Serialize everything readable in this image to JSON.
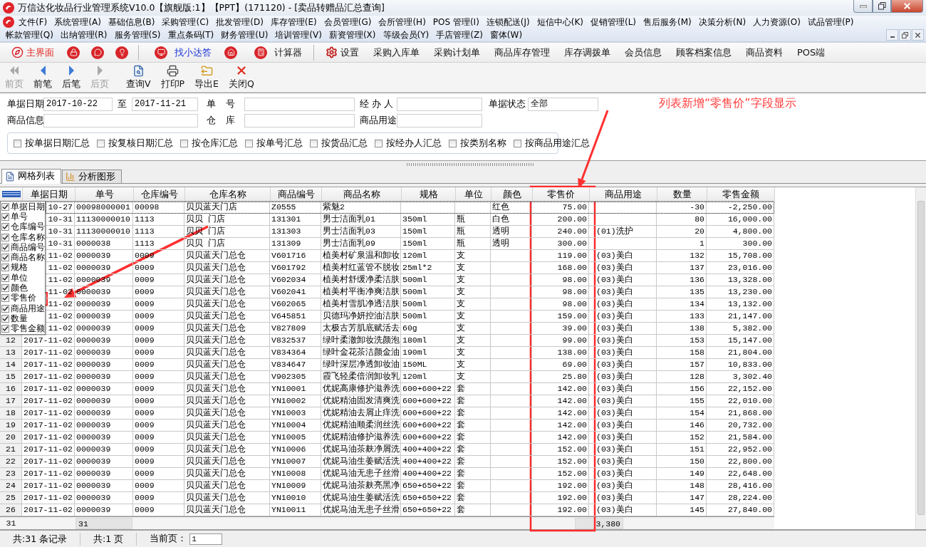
{
  "window": {
    "title": "万信达化妆品行业管理系统V10.0【旗舰版:1】【PPT】(171120) - [卖品转赠品汇总查询]"
  },
  "menu_rows": [
    [
      "文件(F)",
      "系统管理(A)",
      "基础信息(B)",
      "采购管理(C)",
      "批发管理(D)",
      "库存管理(E)",
      "会员管理(G)",
      "会所管理(H)",
      "POS 管理(I)",
      "连锁配送(J)",
      "短信中心(K)",
      "促销管理(L)",
      "售后服务(M)",
      "决策分析(N)",
      "人力资源(O)",
      "试品管理(P)"
    ],
    [
      "帐款管理(Q)",
      "出纳管理(R)",
      "服务管理(S)",
      "重点条码(T)",
      "财务管理(U)",
      "培训管理(V)",
      "薪资管理(X)",
      "等级会员(Y)",
      "手店管理(Z)",
      "窗体(W)"
    ]
  ],
  "quick_toolbar": [
    {
      "label": "主界面",
      "kind": "red"
    },
    {
      "label": "找小达答",
      "kind": "blue"
    },
    {
      "label": "计算器",
      "kind": "plain"
    },
    {
      "label": "设置",
      "kind": "plain"
    },
    {
      "label": "采购入库单",
      "kind": "plain"
    },
    {
      "label": "采购计划单",
      "kind": "plain"
    },
    {
      "label": "商品库存管理",
      "kind": "plain"
    },
    {
      "label": "库存调拨单",
      "kind": "plain"
    },
    {
      "label": "会员信息",
      "kind": "plain"
    },
    {
      "label": "顾客档案信息",
      "kind": "plain"
    },
    {
      "label": "商品资料",
      "kind": "plain"
    },
    {
      "label": "POS端",
      "kind": "plain"
    }
  ],
  "nav_toolbar": [
    {
      "label": "前页",
      "disabled": true
    },
    {
      "label": "前笔",
      "disabled": false
    },
    {
      "label": "后笔",
      "disabled": false
    },
    {
      "label": "后页",
      "disabled": true
    },
    {
      "label": "查询V",
      "disabled": false
    },
    {
      "label": "打印P",
      "disabled": false
    },
    {
      "label": "导出E",
      "disabled": false
    },
    {
      "label": "关闭Q",
      "disabled": false
    }
  ],
  "filters": {
    "fields": [
      {
        "label": "单据日期",
        "value": "2017-10-22"
      },
      {
        "label": "至",
        "value": "2017-11-21"
      },
      {
        "label": "单 号"
      },
      {
        "label": "经 办 人"
      },
      {
        "label": "单据状态",
        "value": "全部"
      },
      {
        "label": "商品信息"
      },
      {
        "label": "仓 库"
      },
      {
        "label": "商品用途"
      }
    ],
    "group_options": [
      {
        "label": "按单据日期汇总",
        "checked": false
      },
      {
        "label": "按复核日期汇总",
        "checked": false
      },
      {
        "label": "按仓库汇总",
        "checked": false
      },
      {
        "label": "按单号汇总",
        "checked": false
      },
      {
        "label": "按货品汇总",
        "checked": false
      },
      {
        "label": "按经办人汇总",
        "checked": false
      },
      {
        "label": "按类别名称",
        "checked": false
      },
      {
        "label": "按商品用途汇总",
        "checked": false
      }
    ]
  },
  "annotation": {
    "text": "列表新增“零售价”字段显示"
  },
  "tabs": [
    {
      "label": "网格列表",
      "selected": true
    },
    {
      "label": "分析图形",
      "selected": false
    }
  ],
  "table": {
    "columns": [
      "单据日期",
      "单号",
      "仓库编号",
      "仓库名称",
      "商品编号",
      "商品名称",
      "规格",
      "单位",
      "颜色",
      "零售价",
      "商品用途",
      "数量",
      "零售金额"
    ],
    "rows": [
      {
        "selected": true,
        "date": "10-27",
        "order_no": "00098000001",
        "warehouse_code": "00098",
        "warehouse_name": "贝贝蓝天门店",
        "item_code": "Z0555",
        "item_name": "紫魅2",
        "product_color": "红色",
        "retail_price": "75.00",
        "quantity": "-30",
        "amount": "-2,250.00"
      },
      {
        "selected": false,
        "date": "10-31",
        "order_no": "11130000010",
        "warehouse_code": "1113",
        "warehouse_name": "贝贝 门店",
        "item_code": "131301",
        "item_name": "男士洁面乳01",
        "spec": "350ml",
        "unit": "瓶",
        "product_color": "白色",
        "retail_price": "200.00",
        "quantity": "80",
        "amount": "16,000.00"
      },
      {
        "selected": false,
        "date": "10-31",
        "order_no": "11130000010",
        "warehouse_code": "1113",
        "warehouse_name": "贝贝 门店",
        "item_code": "131303",
        "item_name": "男士洁面乳03",
        "spec": "150ml",
        "unit": "瓶",
        "product_color": "透明",
        "retail_price": "240.00",
        "usage": "(01)洗护",
        "quantity": "20",
        "amount": "4,800.00"
      },
      {
        "selected": false,
        "date": "10-31",
        "order_no": "0000038",
        "warehouse_code": "1113",
        "warehouse_name": "贝贝 门店",
        "item_code": "131309",
        "item_name": "男士洁面乳09",
        "spec": "150ml",
        "unit": "瓶",
        "product_color": "透明",
        "retail_price": "300.00",
        "quantity": "1",
        "amount": "300.00"
      },
      {
        "selected": false,
        "date": "11-02",
        "order_no": "0000039",
        "warehouse_code": "0009",
        "warehouse_name": "贝贝蓝天门总仓",
        "item_code": "V601716",
        "item_name": "植美村矿泉温和卸妆",
        "spec": "120ml",
        "unit": "支",
        "retail_price": "119.00",
        "usage": "(03)美白",
        "quantity": "132",
        "amount": "15,708.00"
      },
      {
        "selected": false,
        "date": "11-02",
        "order_no": "0000039",
        "warehouse_code": "0009",
        "warehouse_name": "贝贝蓝天门总仓",
        "item_code": "V601792",
        "item_name": "植美村红蓝管不脱妆",
        "spec": "25ml*2",
        "unit": "支",
        "retail_price": "168.00",
        "usage": "(03)美白",
        "quantity": "137",
        "amount": "23,016.00"
      },
      {
        "selected": false,
        "date": "11-02",
        "order_no": "0000039",
        "warehouse_code": "0009",
        "warehouse_name": "贝贝蓝天门总仓",
        "item_code": "V602034",
        "item_name": "植美村舒缓净柔洁肤",
        "spec": "500ml",
        "unit": "支",
        "retail_price": "98.00",
        "usage": "(03)美白",
        "quantity": "136",
        "amount": "13,328.00"
      },
      {
        "selected": false,
        "date": "11-02",
        "order_no": "0000039",
        "warehouse_code": "0009",
        "warehouse_name": "贝贝蓝天门总仓",
        "item_code": "V602041",
        "item_name": "植美村平衡净爽洁肤",
        "spec": "500ml",
        "unit": "支",
        "retail_price": "98.00",
        "usage": "(03)美白",
        "quantity": "135",
        "amount": "13,230.00"
      },
      {
        "selected": false,
        "date": "11-02",
        "order_no": "0000039",
        "warehouse_code": "0009",
        "warehouse_name": "贝贝蓝天门总仓",
        "item_code": "V602065",
        "item_name": "植美村雪肌净透洁肤",
        "spec": "500ml",
        "unit": "支",
        "retail_price": "98.00",
        "usage": "(03)美白",
        "quantity": "134",
        "amount": "13,132.00"
      },
      {
        "selected": false,
        "date": "11-02",
        "order_no": "0000039",
        "warehouse_code": "0009",
        "warehouse_name": "贝贝蓝天门总仓",
        "item_code": "V645851",
        "item_name": "贝德玛净妍控油洁肤",
        "spec": "500ml",
        "unit": "支",
        "retail_price": "159.00",
        "usage": "(03)美白",
        "quantity": "133",
        "amount": "21,147.00"
      },
      {
        "selected": false,
        "date": "11-02",
        "order_no": "0000039",
        "warehouse_code": "0009",
        "warehouse_name": "贝贝蓝天门总仓",
        "item_code": "V827809",
        "item_name": "太极古芳肌底赋活去",
        "spec": "60g",
        "unit": "支",
        "retail_price": "39.00",
        "usage": "(03)美白",
        "quantity": "138",
        "amount": "5,382.00"
      },
      {
        "selected": false,
        "number": "12",
        "date": "2017-11-02",
        "order_no": "0000039",
        "warehouse_code": "0009",
        "warehouse_name": "贝贝蓝天门总仓",
        "item_code": "V832537",
        "item_name": "绿叶柔澈卸妆洗颜泡",
        "spec": "180ml",
        "unit": "支",
        "retail_price": "99.00",
        "usage": "(03)美白",
        "quantity": "153",
        "amount": "15,147.00"
      },
      {
        "selected": false,
        "number": "13",
        "date": "2017-11-02",
        "order_no": "0000039",
        "warehouse_code": "0009",
        "warehouse_name": "贝贝蓝天门总仓",
        "item_code": "V834364",
        "item_name": "绿叶金花茶洁颜金油",
        "spec": "190ml",
        "unit": "支",
        "retail_price": "138.00",
        "usage": "(03)美白",
        "quantity": "158",
        "amount": "21,804.00"
      },
      {
        "selected": false,
        "number": "14",
        "date": "2017-11-02",
        "order_no": "0000039",
        "warehouse_code": "0009",
        "warehouse_name": "贝贝蓝天门总仓",
        "item_code": "V834647",
        "item_name": "绿叶深层净透卸妆油",
        "spec": "150ML",
        "unit": "支",
        "retail_price": "69.00",
        "usage": "(03)美白",
        "quantity": "157",
        "amount": "10,833.00"
      },
      {
        "selected": false,
        "number": "15",
        "date": "2017-11-02",
        "order_no": "0000039",
        "warehouse_code": "0009",
        "warehouse_name": "贝贝蓝天门总仓",
        "item_code": "V902305",
        "item_name": "霞飞轻柔倍润卸妆乳",
        "spec": "120ml",
        "unit": "支",
        "retail_price": "25.80",
        "usage": "(03)美白",
        "quantity": "128",
        "amount": "3,302.40"
      },
      {
        "selected": false,
        "number": "16",
        "date": "2017-11-02",
        "order_no": "0000039",
        "warehouse_code": "0009",
        "warehouse_name": "贝贝蓝天门总仓",
        "item_code": "YN10001",
        "item_name": "优妮高康修护滋养洗",
        "spec": "600+600+22",
        "unit": "套",
        "retail_price": "142.00",
        "usage": "(03)美白",
        "quantity": "156",
        "amount": "22,152.00"
      },
      {
        "selected": false,
        "number": "17",
        "date": "2017-11-02",
        "order_no": "0000039",
        "warehouse_code": "0009",
        "warehouse_name": "贝贝蓝天门总仓",
        "item_code": "YN10002",
        "item_name": "优妮精油固发清爽洗",
        "spec": "600+600+22",
        "unit": "套",
        "retail_price": "142.00",
        "usage": "(03)美白",
        "quantity": "155",
        "amount": "22,010.00"
      },
      {
        "selected": false,
        "number": "18",
        "date": "2017-11-02",
        "order_no": "0000039",
        "warehouse_code": "0009",
        "warehouse_name": "贝贝蓝天门总仓",
        "item_code": "YN10003",
        "item_name": "优妮精油去屑止痒洗",
        "spec": "600+600+22",
        "unit": "套",
        "retail_price": "142.00",
        "usage": "(03)美白",
        "quantity": "154",
        "amount": "21,868.00"
      },
      {
        "selected": false,
        "number": "19",
        "date": "2017-11-02",
        "order_no": "0000039",
        "warehouse_code": "0009",
        "warehouse_name": "贝贝蓝天门总仓",
        "item_code": "YN10004",
        "item_name": "优妮精油顺柔润丝洗",
        "spec": "600+600+22",
        "unit": "套",
        "retail_price": "142.00",
        "usage": "(03)美白",
        "quantity": "146",
        "amount": "20,732.00"
      },
      {
        "selected": false,
        "number": "20",
        "date": "2017-11-02",
        "order_no": "0000039",
        "warehouse_code": "0009",
        "warehouse_name": "贝贝蓝天门总仓",
        "item_code": "YN10005",
        "item_name": "优妮精油修护滋养洗",
        "spec": "600+600+22",
        "unit": "套",
        "retail_price": "142.00",
        "usage": "(03)美白",
        "quantity": "152",
        "amount": "21,584.00"
      },
      {
        "selected": false,
        "number": "21",
        "date": "2017-11-02",
        "order_no": "0000039",
        "warehouse_code": "0009",
        "warehouse_name": "贝贝蓝天门总仓",
        "item_code": "YN10006",
        "item_name": "优妮马油茶麸净屑洗",
        "spec": "400+400+22",
        "unit": "套",
        "retail_price": "152.00",
        "usage": "(03)美白",
        "quantity": "151",
        "amount": "22,952.00"
      },
      {
        "selected": false,
        "number": "22",
        "date": "2017-11-02",
        "order_no": "0000039",
        "warehouse_code": "0009",
        "warehouse_name": "贝贝蓝天门总仓",
        "item_code": "YN10007",
        "item_name": "优妮马油生姜赋活洗",
        "spec": "400+400+22",
        "unit": "套",
        "retail_price": "152.00",
        "usage": "(03)美白",
        "quantity": "150",
        "amount": "22,800.00"
      },
      {
        "selected": false,
        "number": "23",
        "date": "2017-11-02",
        "order_no": "0000039",
        "warehouse_code": "0009",
        "warehouse_name": "贝贝蓝天门总仓",
        "item_code": "YN10008",
        "item_name": "优妮马油无患子丝滑",
        "spec": "400+400+22",
        "unit": "套",
        "retail_price": "152.00",
        "usage": "(03)美白",
        "quantity": "149",
        "amount": "22,648.00"
      },
      {
        "selected": false,
        "number": "24",
        "date": "2017-11-02",
        "order_no": "0000039",
        "warehouse_code": "0009",
        "warehouse_name": "贝贝蓝天门总仓",
        "item_code": "YN10009",
        "item_name": "优妮马油茶麸亮黑净",
        "spec": "650+650+22",
        "unit": "套",
        "retail_price": "192.00",
        "usage": "(03)美白",
        "quantity": "148",
        "amount": "28,416.00"
      },
      {
        "selected": false,
        "number": "25",
        "date": "2017-11-02",
        "order_no": "0000039",
        "warehouse_code": "0009",
        "warehouse_name": "贝贝蓝天门总仓",
        "item_code": "YN10010",
        "item_name": "优妮马油生姜赋活洗",
        "spec": "650+650+22",
        "unit": "套",
        "retail_price": "192.00",
        "usage": "(03)美白",
        "quantity": "147",
        "amount": "28,224.00"
      },
      {
        "selected": false,
        "number": "26",
        "date": "2017-11-02",
        "order_no": "0000039",
        "warehouse_code": "0009",
        "warehouse_name": "贝贝蓝天门总仓",
        "item_code": "YN10011",
        "item_name": "优妮马油无患子丝滑",
        "spec": "650+650+22",
        "unit": "套",
        "retail_price": "192.00",
        "usage": "(03)美白",
        "quantity": "145",
        "amount": "27,840.00"
      }
    ],
    "footer": {
      "row_count": "31",
      "order_count": "31",
      "quantity_total": "3,380"
    }
  },
  "column_chooser": [
    {
      "label": "单据日期",
      "checked": true
    },
    {
      "label": "单号",
      "checked": true
    },
    {
      "label": "仓库编号",
      "checked": true
    },
    {
      "label": "仓库名称",
      "checked": true
    },
    {
      "label": "商品编号",
      "checked": true
    },
    {
      "label": "商品名称",
      "checked": true
    },
    {
      "label": "规格",
      "checked": true
    },
    {
      "label": "单位",
      "checked": true
    },
    {
      "label": "颜色",
      "checked": true
    },
    {
      "label": "零售价",
      "checked": true
    },
    {
      "label": "商品用途",
      "checked": true
    },
    {
      "label": "数量",
      "checked": true
    },
    {
      "label": "零售金额",
      "checked": true
    }
  ],
  "status_bar": {
    "records": "共:31 条记录",
    "pages": "共:1 页",
    "current_page_label": "当前页：",
    "current_page": "1"
  }
}
